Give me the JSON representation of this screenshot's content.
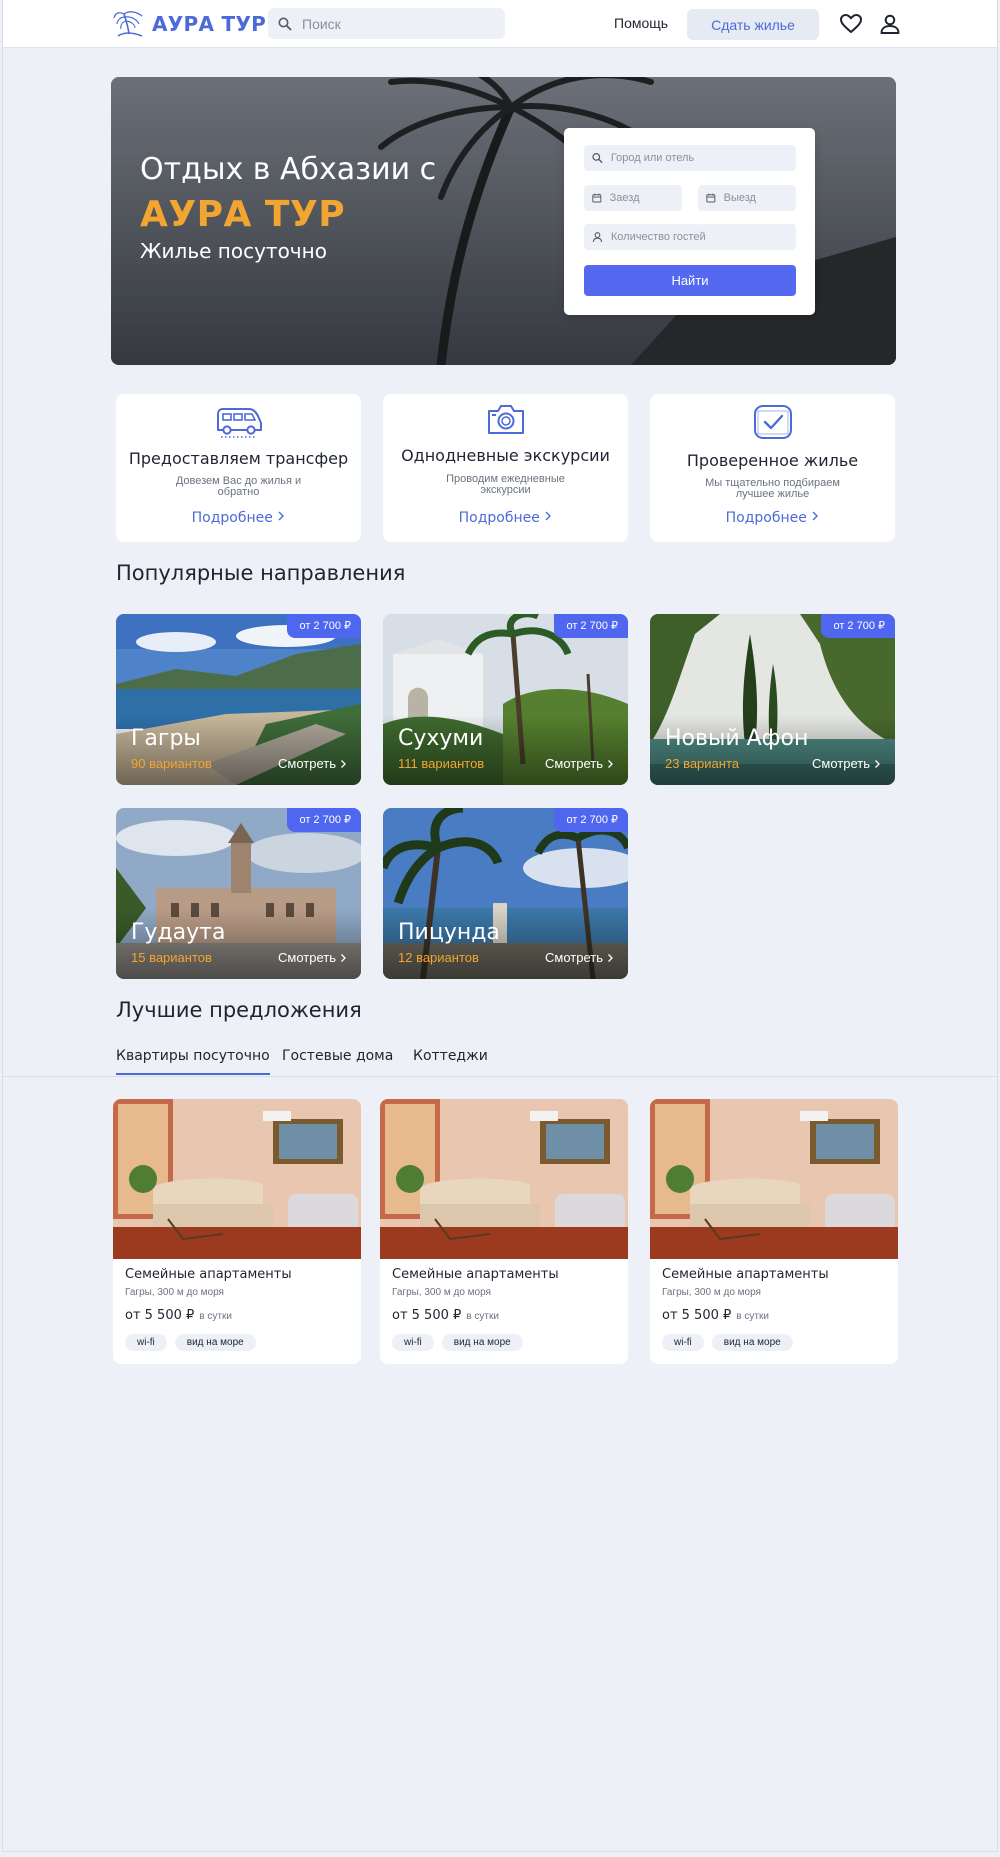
{
  "header": {
    "logo_text": "АУРА ТУР",
    "search_placeholder": "Поиск",
    "help_label": "Помощь",
    "rent_label": "Сдать жилье",
    "icons": [
      "favorites-heart-icon",
      "user-profile-icon"
    ]
  },
  "hero": {
    "title_line1": "Отдых в Абхазии с",
    "title_brand": "АУРА ТУР",
    "subtitle": "Жилье посуточно",
    "booking": {
      "city_placeholder": "Город или отель",
      "checkin_placeholder": "Заезд",
      "checkout_placeholder": "Выезд",
      "guests_placeholder": "Количество гостей",
      "find_label": "Найти"
    }
  },
  "features": [
    {
      "icon": "transfer-bus-icon",
      "title": "Предоставляем трансфер",
      "description": "Довезем Вас до жилья и обратно",
      "more": "Подробнее"
    },
    {
      "icon": "camera-icon",
      "title": "Однодневные экскурсии",
      "description": "Проводим ежедневные экскурсии",
      "more": "Подробнее"
    },
    {
      "icon": "verified-check-icon",
      "title": "Проверенное жилье",
      "description": "Мы тщательно подбираем лучшее жилье",
      "more": "Подробнее"
    }
  ],
  "popular": {
    "title": "Популярные направления",
    "destinations": [
      {
        "name": "Гагры",
        "count": "90 вариантов",
        "price": "от 2 700 ₽",
        "view": "Смотреть"
      },
      {
        "name": "Сухуми",
        "count": "111 вариантов",
        "price": "от 2 700 ₽",
        "view": "Смотреть"
      },
      {
        "name": "Новый Афон",
        "count": "23 варианта",
        "price": "от 2 700 ₽",
        "view": "Смотреть"
      },
      {
        "name": "Гудаута",
        "count": "15 вариантов",
        "price": "от 2 700 ₽",
        "view": "Смотреть"
      },
      {
        "name": "Пицунда",
        "count": "12 вариантов",
        "price": "от 2 700 ₽",
        "view": "Смотреть"
      }
    ]
  },
  "offers": {
    "title": "Лучшие предложения",
    "tabs": [
      "Квартиры посуточно",
      "Гостевые дома",
      "Коттеджи"
    ],
    "active_tab": "Квартиры посуточно",
    "items": [
      {
        "title": "Семейные апартаменты",
        "location": "Гагры, 300 м до моря",
        "price": "от 5 500 ₽",
        "unit": "в сутки",
        "tags": [
          "wi-fi",
          "вид на море"
        ]
      },
      {
        "title": "Семейные апартаменты",
        "location": "Гагры, 300 м до моря",
        "price": "от 5 500 ₽",
        "unit": "в сутки",
        "tags": [
          "wi-fi",
          "вид на море"
        ]
      },
      {
        "title": "Семейные апартаменты",
        "location": "Гагры, 300 м до моря",
        "price": "от 5 500 ₽",
        "unit": "в сутки",
        "tags": [
          "wi-fi",
          "вид на море"
        ]
      }
    ]
  },
  "colors": {
    "accent": "#4c6ad8",
    "button": "#5468f0",
    "brand_orange": "#f3a531",
    "background": "#edf0f6"
  }
}
